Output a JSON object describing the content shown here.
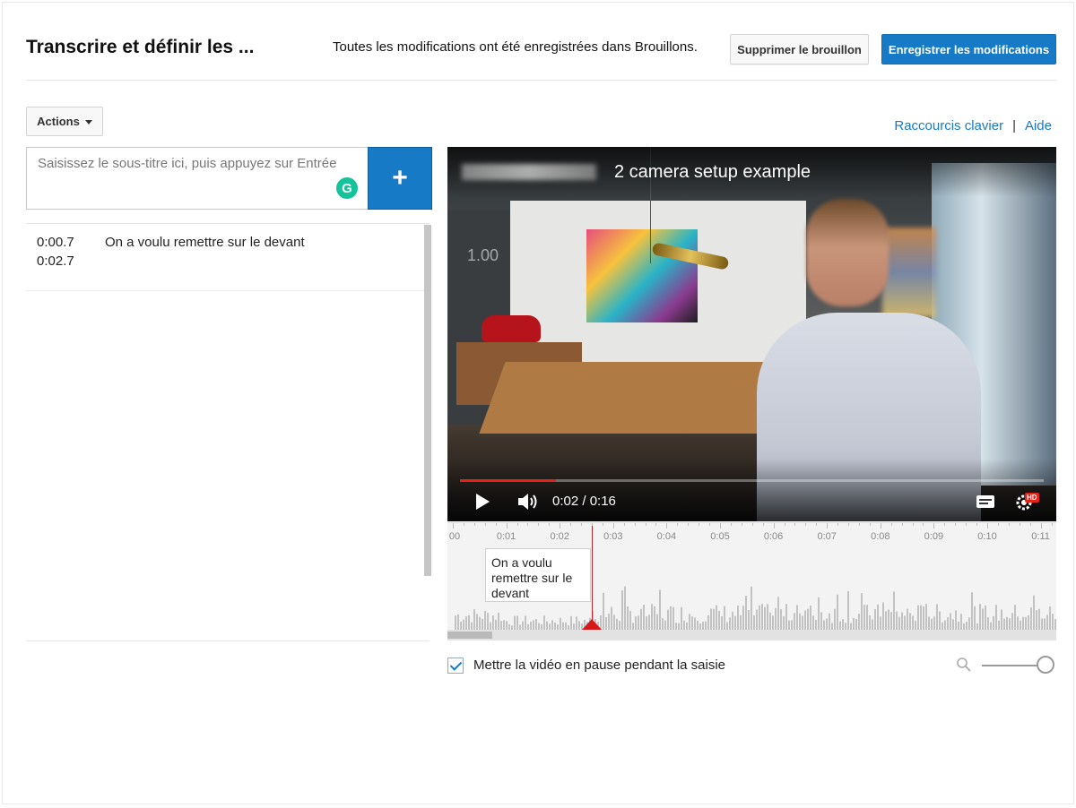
{
  "header": {
    "title": "Transcrire et définir les ...",
    "save_status": "Toutes les modifications ont été enregistrées dans Brouillons.",
    "discard_label": "Supprimer le brouillon",
    "save_label": "Enregistrer les modifications"
  },
  "toolbar": {
    "actions_label": "Actions",
    "shortcuts_label": "Raccourcis clavier",
    "separator": "|",
    "help_label": "Aide"
  },
  "caption_input": {
    "placeholder": "Saisissez le sous-titre ici, puis appuyez sur Entrée",
    "value": "",
    "add_symbol": "+",
    "grammarly_symbol": "G"
  },
  "captions": [
    {
      "start": "0:00.7",
      "end": "0:02.7",
      "text": "On a voulu remettre sur le devant"
    }
  ],
  "video": {
    "title": "2 camera setup example",
    "watermark": "1.00",
    "current_time": "0:02",
    "duration": "0:16",
    "time_display": "0:02 / 0:16",
    "hd_badge": "HD",
    "progress_fraction": 0.165
  },
  "timeline": {
    "tick_labels": [
      "00",
      "0:01",
      "0:02",
      "0:03",
      "0:04",
      "0:05",
      "0:06",
      "0:07",
      "0:08",
      "0:09",
      "0:10",
      "0:11"
    ],
    "caption_block_text": "On a voulu remettre sur le devant",
    "playhead_time_seconds": 2.7
  },
  "options": {
    "pause_while_typing_label": "Mettre la vidéo en pause pendant la saisie",
    "pause_while_typing_checked": true,
    "zoom_fraction": 1.0
  },
  "colors": {
    "accent": "#167ac6",
    "progress": "#e62117",
    "grammarly": "#15c39a"
  }
}
